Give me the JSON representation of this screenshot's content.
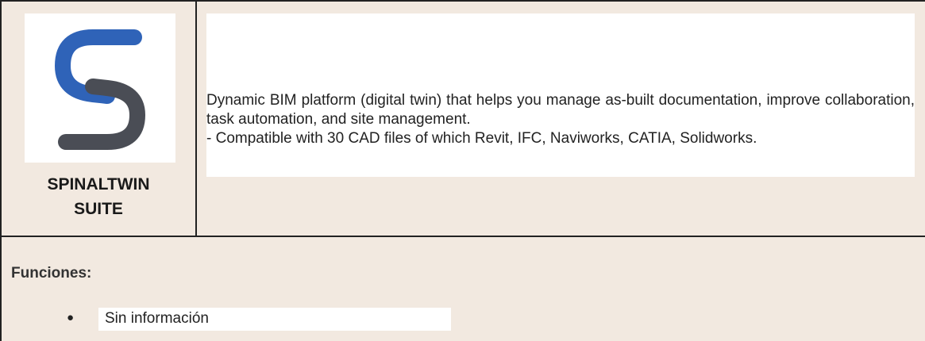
{
  "product": {
    "name_line1": "SPINALTWIN",
    "name_line2": "SUITE",
    "logo_icon": "spinaltwin-s-logo",
    "logo_colors": {
      "blue": "#2f63b8",
      "gray": "#4a4d55"
    }
  },
  "description": {
    "paragraph1": "Dynamic BIM platform (digital twin) that helps you manage as-built documentation, improve collaboration, task automation, and site management.",
    "paragraph2": "- Compatible with 30 CAD files of which Revit, IFC, Naviworks, CATIA, Solidworks."
  },
  "functions": {
    "heading": "Funciones:",
    "items": [
      {
        "bullet": "●",
        "label": "Sin información"
      }
    ]
  }
}
